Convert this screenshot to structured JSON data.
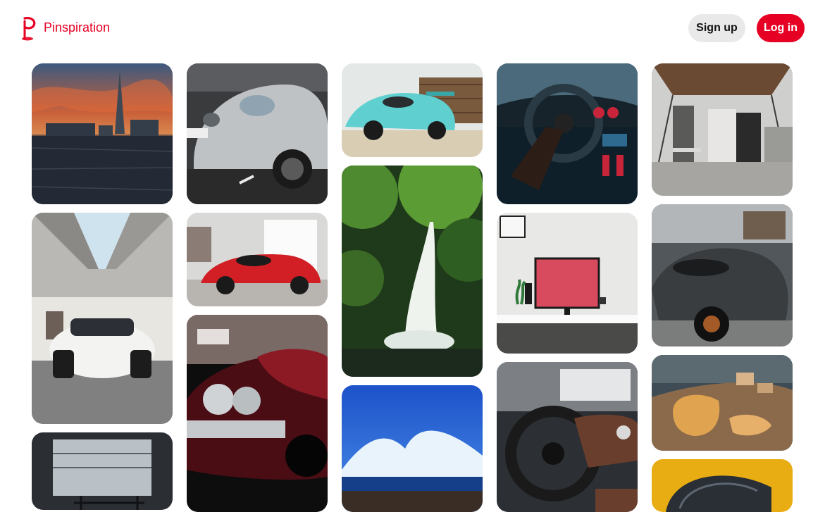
{
  "header": {
    "brand_name": "Pinspiration",
    "logo_icon": "pin-logo-icon",
    "signup_label": "Sign up",
    "login_label": "Log in",
    "brand_color": "#e60023",
    "signup_bg": "#e9e9e9"
  },
  "pins": [
    {
      "id": "pin-city-sunset",
      "column": 1,
      "subject": "city skyline at sunset over river"
    },
    {
      "id": "pin-white-sports-car",
      "column": 1,
      "subject": "white sports car under concrete bridge"
    },
    {
      "id": "pin-stairwell",
      "column": 1,
      "subject": "interior with staircase and railing"
    },
    {
      "id": "pin-silver-porsche",
      "column": 2,
      "subject": "silver sports car front"
    },
    {
      "id": "pin-red-ferrari",
      "column": 2,
      "subject": "red supercar in showroom"
    },
    {
      "id": "pin-classic-car",
      "column": 2,
      "subject": "classic dark red car headlights"
    },
    {
      "id": "pin-teal-porsche",
      "column": 3,
      "subject": "teal sports car by shipping container"
    },
    {
      "id": "pin-waterfall",
      "column": 3,
      "subject": "waterfall in green forest"
    },
    {
      "id": "pin-wave",
      "column": 3,
      "subject": "ocean wave crashing on rocks"
    },
    {
      "id": "pin-dashboard",
      "column": 4,
      "subject": "driving car interior at night"
    },
    {
      "id": "pin-desk-setup",
      "column": 4,
      "subject": "desk with monitor and plant"
    },
    {
      "id": "pin-porsche-interior",
      "column": 4,
      "subject": "car steering wheel interior"
    },
    {
      "id": "pin-loft",
      "column": 5,
      "subject": "loft interior with sliding door"
    },
    {
      "id": "pin-grey-mclaren",
      "column": 5,
      "subject": "grey supercar in garage"
    },
    {
      "id": "pin-cheese",
      "column": 5,
      "subject": "cheese on wooden board"
    },
    {
      "id": "pin-yellow-car",
      "column": 5,
      "subject": "yellow car detail"
    }
  ]
}
